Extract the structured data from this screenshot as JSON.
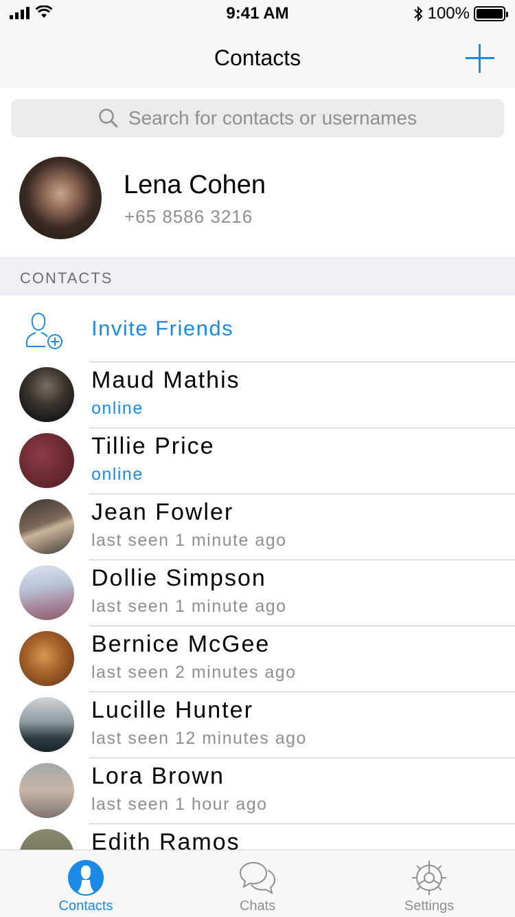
{
  "status_bar": {
    "time": "9:41 AM",
    "battery": "100%"
  },
  "nav": {
    "title": "Contacts",
    "add_icon": "plus-icon"
  },
  "search": {
    "placeholder": "Search for contacts or usernames"
  },
  "profile": {
    "name": "Lena Cohen",
    "phone": "+65 8586 3216"
  },
  "section": {
    "header": "CONTACTS"
  },
  "invite": {
    "label": "Invite Friends",
    "icon": "add-user-icon"
  },
  "contacts": [
    {
      "name": "Maud Mathis",
      "status": "online",
      "online": true
    },
    {
      "name": "Tillie Price",
      "status": "online",
      "online": true
    },
    {
      "name": "Jean Fowler",
      "status": "last seen 1 minute ago",
      "online": false
    },
    {
      "name": "Dollie Simpson",
      "status": "last seen 1 minute ago",
      "online": false
    },
    {
      "name": "Bernice McGee",
      "status": "last seen 2 minutes ago",
      "online": false
    },
    {
      "name": "Lucille Hunter",
      "status": "last seen 12 minutes ago",
      "online": false
    },
    {
      "name": "Lora Brown",
      "status": "last seen 1 hour ago",
      "online": false
    },
    {
      "name": "Edith Ramos",
      "status": "",
      "online": false
    }
  ],
  "tabs": [
    {
      "label": "Contacts",
      "icon": "person-icon",
      "active": true
    },
    {
      "label": "Chats",
      "icon": "chat-bubbles-icon",
      "active": false
    },
    {
      "label": "Settings",
      "icon": "gear-icon",
      "active": false
    }
  ],
  "colors": {
    "accent": "#1a8ae6",
    "secondary_text": "#8e8e93",
    "bar_background": "#f7f7f7"
  }
}
